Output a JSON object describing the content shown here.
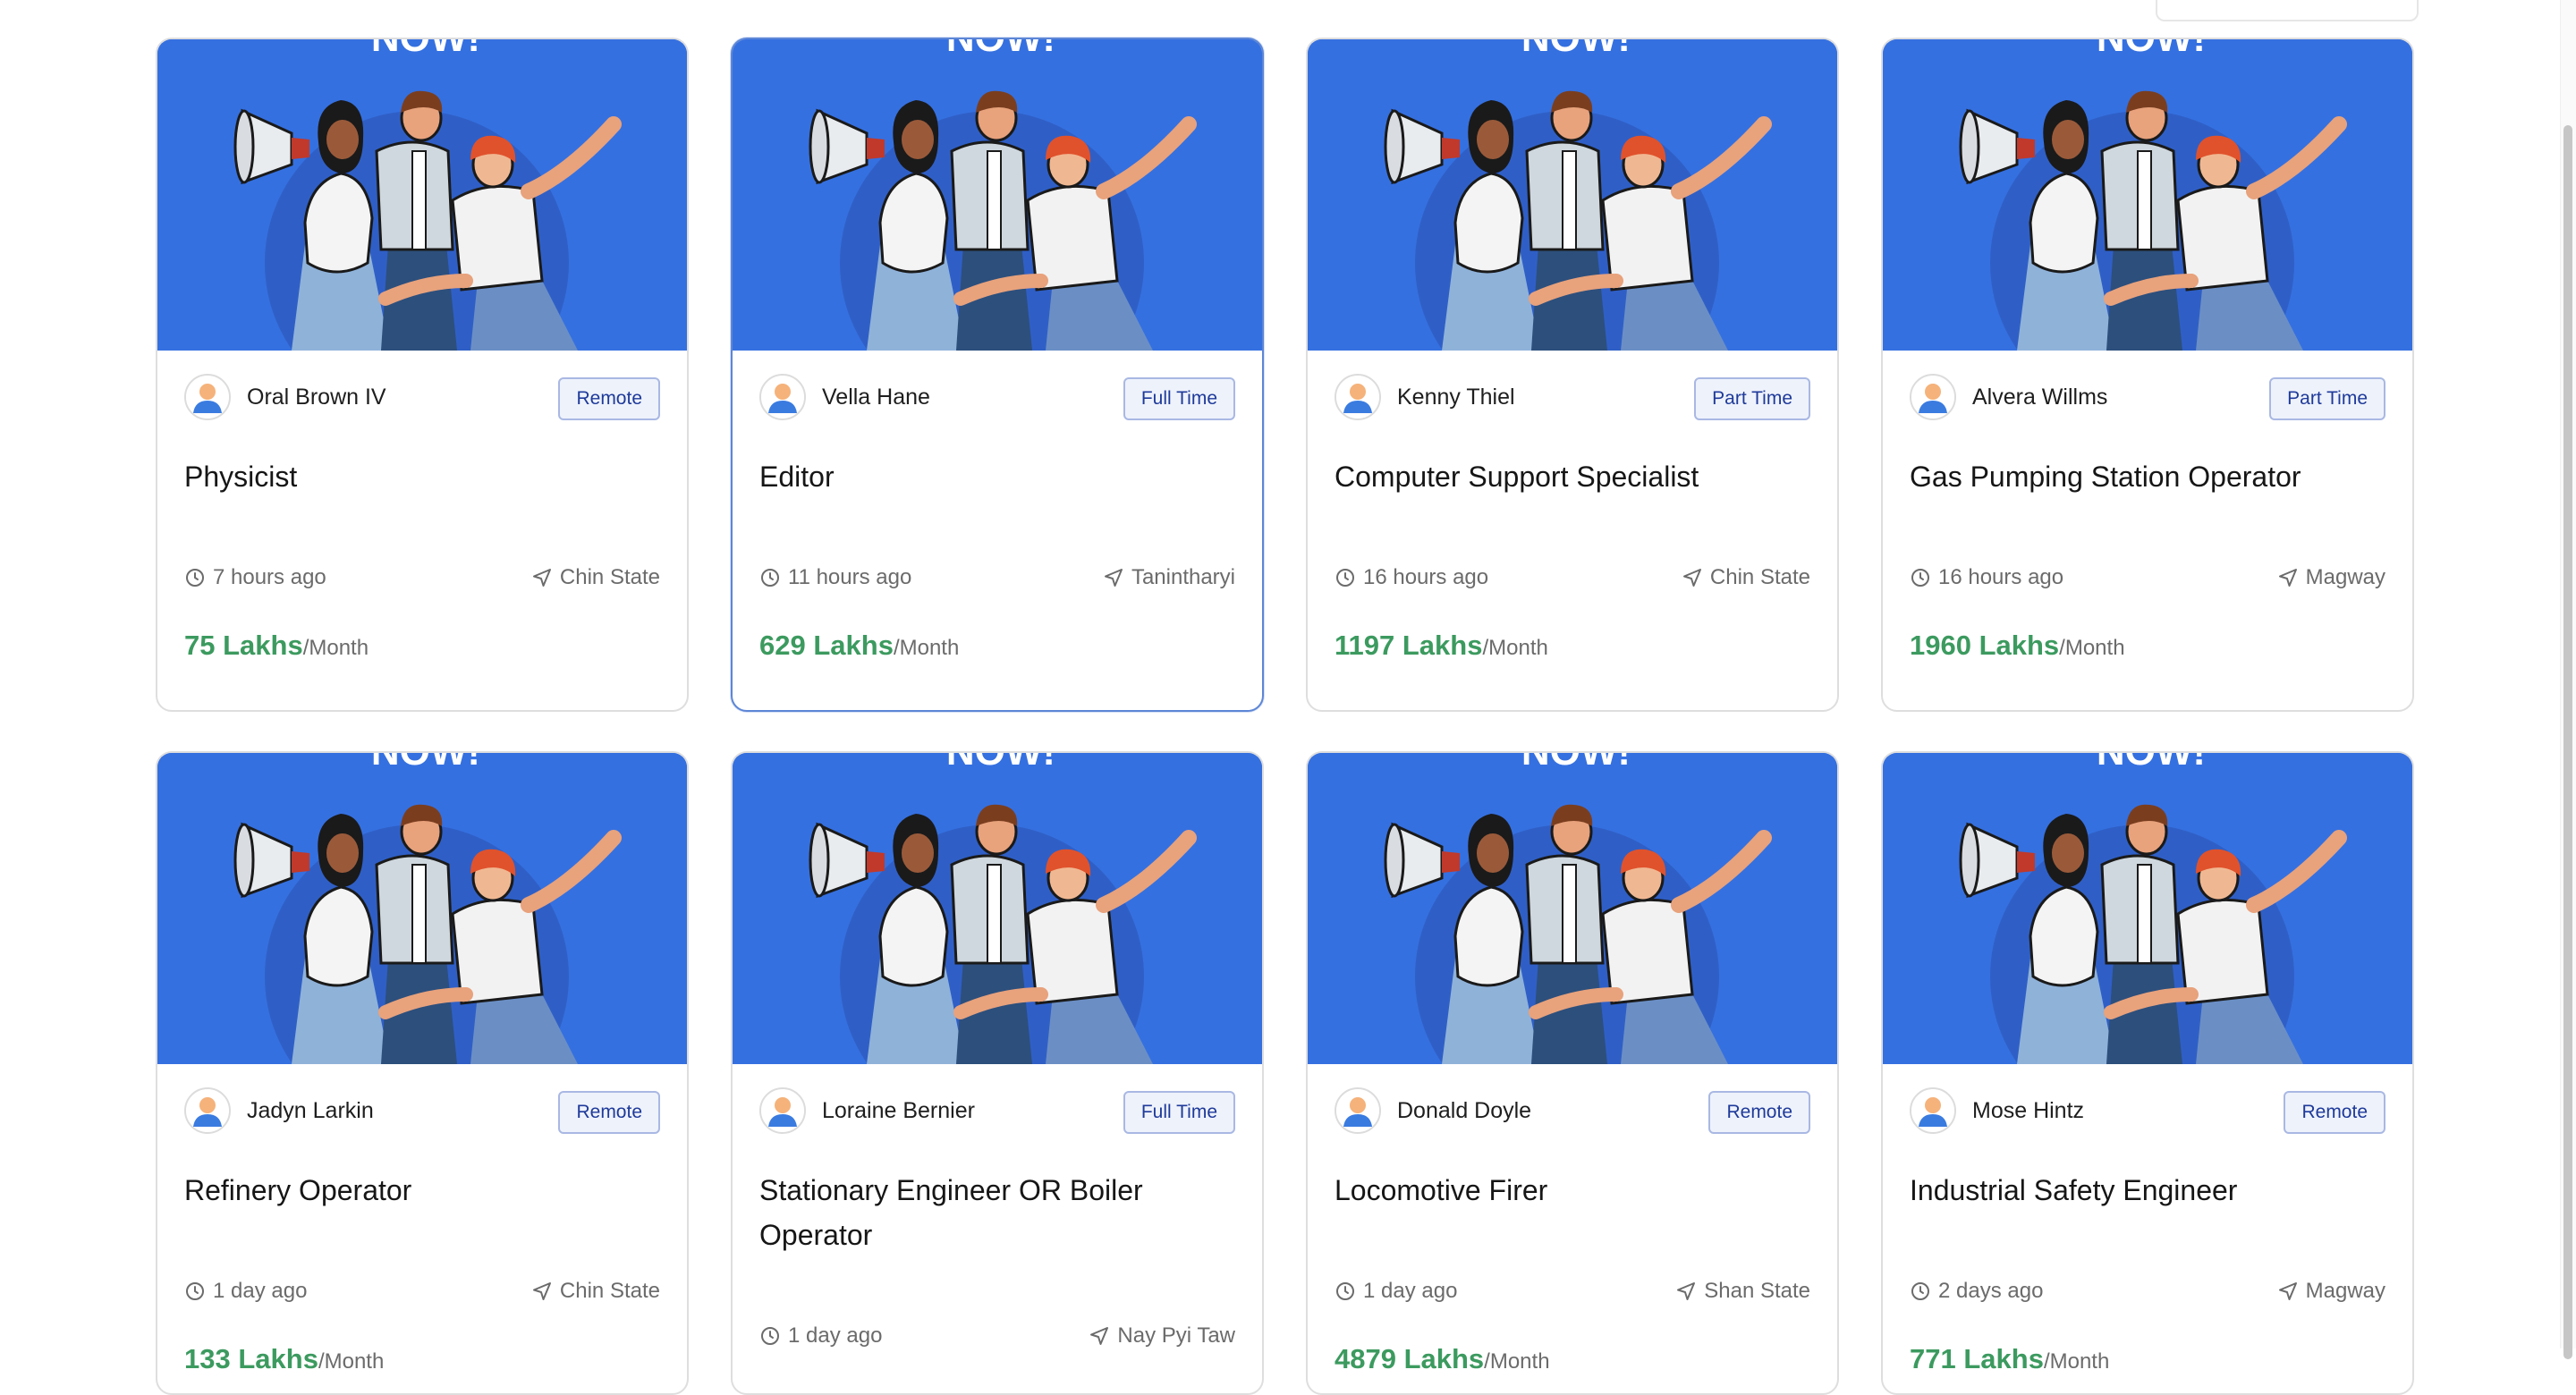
{
  "jobs": [
    {
      "poster": "Oral Brown IV",
      "type": "Remote",
      "title": "Physicist",
      "time": "7 hours ago",
      "location": "Chin State",
      "salary": "75 Lakhs",
      "per": "/Month"
    },
    {
      "poster": "Vella Hane",
      "type": "Full Time",
      "title": "Editor",
      "time": "11 hours ago",
      "location": "Tanintharyi",
      "salary": "629 Lakhs",
      "per": "/Month"
    },
    {
      "poster": "Kenny Thiel",
      "type": "Part Time",
      "title": "Computer Support Specialist",
      "time": "16 hours ago",
      "location": "Chin State",
      "salary": "1197 Lakhs",
      "per": "/Month"
    },
    {
      "poster": "Alvera Willms",
      "type": "Part Time",
      "title": "Gas Pumping Station Operator",
      "time": "16 hours ago",
      "location": "Magway",
      "salary": "1960 Lakhs",
      "per": "/Month"
    },
    {
      "poster": "Jadyn Larkin",
      "type": "Remote",
      "title": "Refinery Operator",
      "time": "1 day ago",
      "location": "Chin State",
      "salary": "133 Lakhs",
      "per": "/Month"
    },
    {
      "poster": "Loraine Bernier",
      "type": "Full Time",
      "title": "Stationary Engineer OR Boiler Operator",
      "time": "1 day ago",
      "location": "Nay Pyi Taw",
      "salary": "",
      "per": ""
    },
    {
      "poster": "Donald Doyle",
      "type": "Remote",
      "title": "Locomotive Firer",
      "time": "1 day ago",
      "location": "Shan State",
      "salary": "4879 Lakhs",
      "per": "/Month"
    },
    {
      "poster": "Mose Hintz",
      "type": "Remote",
      "title": "Industrial Safety Engineer",
      "time": "2 days ago",
      "location": "Magway",
      "salary": "771 Lakhs",
      "per": "/Month"
    }
  ],
  "banner_text": "NOW!",
  "colors": {
    "banner": "#3570e0",
    "salary": "#3c9a5f",
    "badge_text": "#1e3a9a",
    "card_border": "#dedede",
    "active_border": "#5d86d6"
  },
  "icons": {
    "time": "clock-icon",
    "location": "navigation-arrow-icon",
    "avatar": "user-avatar-icon",
    "banner": "hiring-people-illustration"
  }
}
